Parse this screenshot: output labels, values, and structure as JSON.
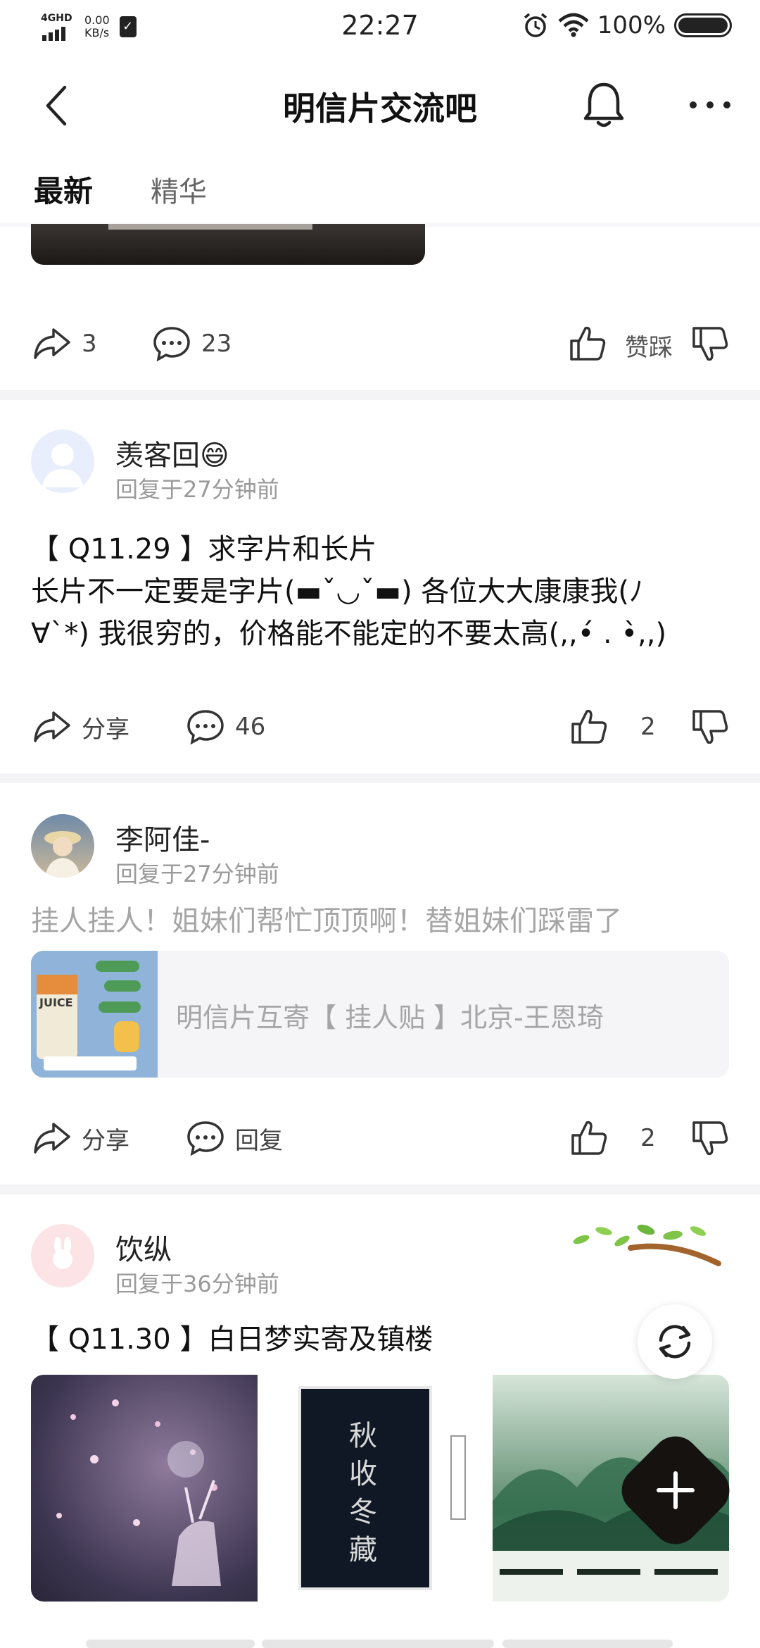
{
  "status_bar": {
    "network": "4GHD",
    "speed_value": "0.00",
    "speed_unit": "KB/s",
    "time": "22:27",
    "battery": "100%",
    "icons": [
      "signal-icon",
      "sim-check-icon",
      "alarm-icon",
      "wifi-icon",
      "battery-icon"
    ]
  },
  "header": {
    "title": "明信片交流吧",
    "icons": [
      "back-icon",
      "bell-icon",
      "more-icon"
    ]
  },
  "tabs": [
    {
      "label": "最新",
      "active": true
    },
    {
      "label": "精华",
      "active": false
    }
  ],
  "prev_post": {
    "share_count": "3",
    "comment_count": "23",
    "vote_label": "赞踩"
  },
  "posts": [
    {
      "user": "羡客回😄",
      "meta": "回复于27分钟前",
      "text_line1": "【 Q11.29 】求字片和长片",
      "text_line2": "长片不一定要是字片(▬ˇ◡ˇ▬) 各位大大康康我(ﾉ",
      "text_line3": "∀`*) 我很穷的，价格能不能定的不要太高(,,•́ . •̀,,)",
      "share_label": "分享",
      "comment_count": "46",
      "like_count": "2"
    },
    {
      "user": "李阿佳-",
      "meta": "回复于27分钟前",
      "text": "挂人挂人！姐妹们帮忙顶顶啊！替姐妹们踩雷了",
      "link_title": "明信片互寄【 挂人贴 】北京-王恩琦",
      "thumb_text": "JUICE",
      "share_label": "分享",
      "reply_label": "回复",
      "like_count": "2"
    },
    {
      "user": "饮纵",
      "meta": "回复于36分钟前",
      "title": "【 Q11.30 】白日梦实寄及镇楼",
      "image2_text": "秋收冬藏"
    }
  ],
  "colors": {
    "separator": "#f4f3f6",
    "muted_text": "#9a9a9a",
    "fab": "#15120f"
  }
}
